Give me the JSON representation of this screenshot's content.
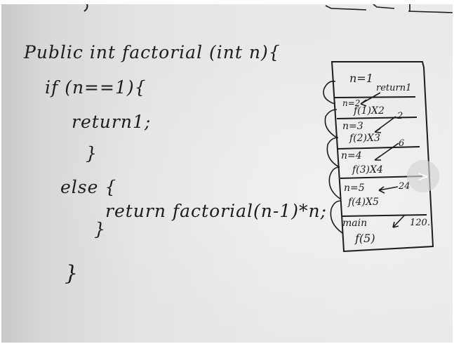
{
  "code": {
    "line1": "Public int factorial (int n){",
    "line2": "if (n==1){",
    "line3": "return1;",
    "line4": "}",
    "line5": "else {",
    "line6": "return factorial(n-1)*n;",
    "line7": "}",
    "line8": "}"
  },
  "stack": {
    "frame1_label": "n=1",
    "frame1_note": "return1",
    "frame2_label": "n=2",
    "frame2_call": "f(1)X2",
    "frame2_result": "2",
    "frame3_label": "n=3",
    "frame3_call": "f(2)X3",
    "frame3_result": "6",
    "frame4_label": "n=4",
    "frame4_call": "f(3)X4",
    "frame5_label": "n=5",
    "frame5_result": "24",
    "frame5_call": "f(4)X5",
    "frame6_label": "main",
    "frame6_call": "f(5)",
    "frame6_result": "120."
  },
  "controls": {
    "next_icon": "chevron-right-icon",
    "next_glyph": ">"
  },
  "colors": {
    "ink": "#1c1c1c",
    "board": "#e6e6e6"
  }
}
